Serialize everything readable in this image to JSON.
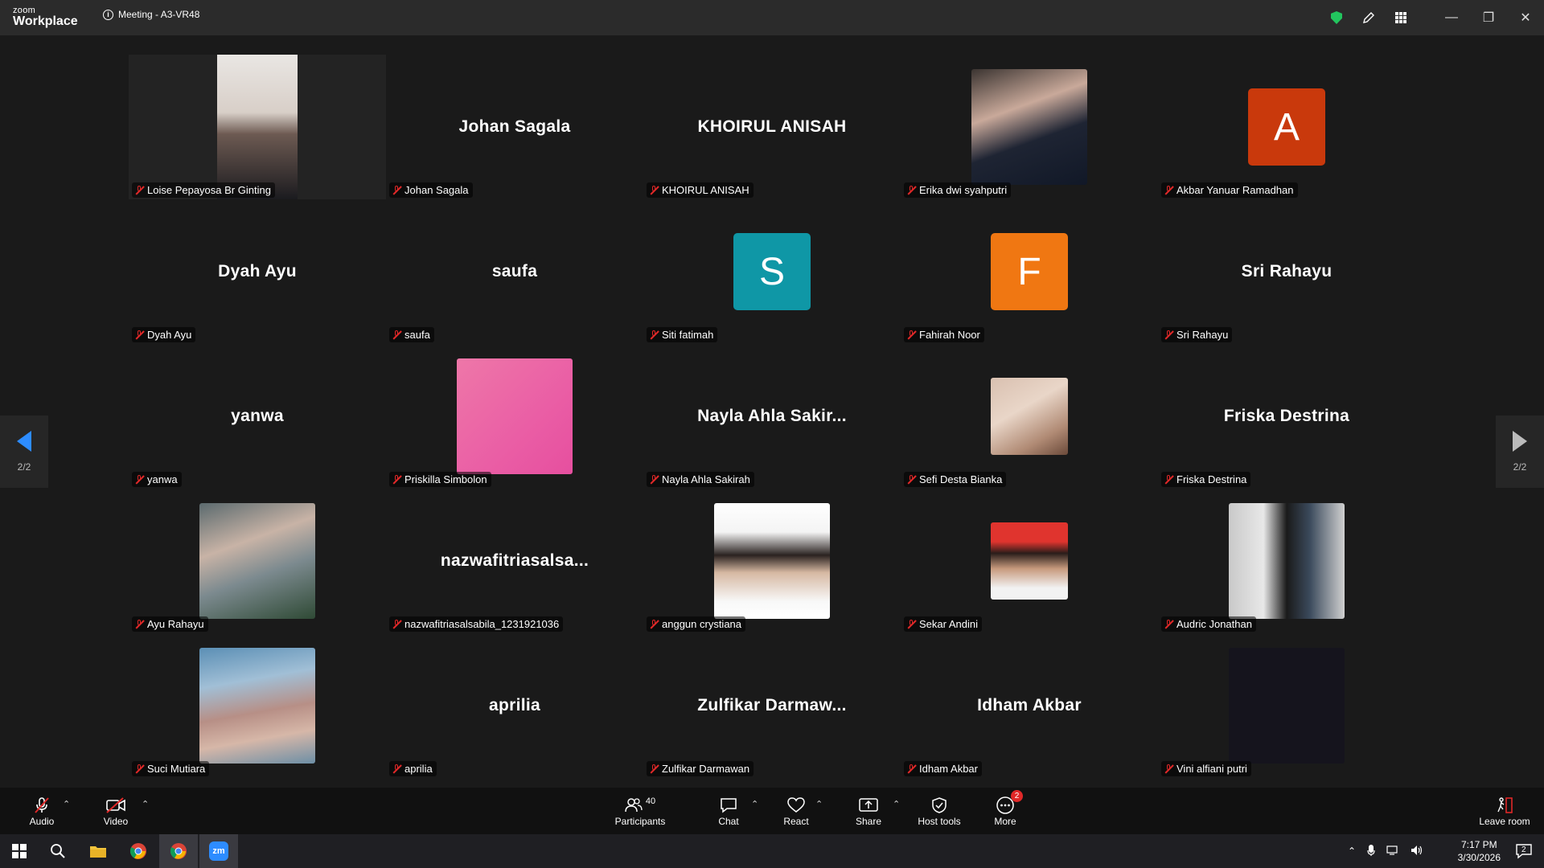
{
  "titlebar": {
    "brand_top": "zoom",
    "brand_bottom": "Workplace",
    "meeting_title": "Meeting - A3-VR48"
  },
  "colors": {
    "avatar_A": "#c9390c",
    "avatar_S": "#0f97a6",
    "avatar_F": "#f07712",
    "avatar_pink": "#ea5ea5",
    "shield": "#22c55e",
    "mic_off": "#e02828",
    "nav_active": "#2d8cff"
  },
  "gallery": {
    "page_left": "2/2",
    "page_right": "2/2",
    "tiles": [
      {
        "name": "Loise Pepayosa Br Ginting",
        "display": "",
        "type": "video"
      },
      {
        "name": "Johan Sagala",
        "display": "Johan Sagala",
        "type": "text"
      },
      {
        "name": "KHOIRUL ANISAH",
        "display": "KHOIRUL ANISAH",
        "type": "text"
      },
      {
        "name": "Erika dwi syahputri",
        "display": "",
        "type": "photo"
      },
      {
        "name": "Akbar Yanuar Ramadhan",
        "display": "A",
        "type": "avatar"
      },
      {
        "name": "Dyah Ayu",
        "display": "Dyah Ayu",
        "type": "text"
      },
      {
        "name": "saufa",
        "display": "saufa",
        "type": "text"
      },
      {
        "name": "Siti fatimah",
        "display": "S",
        "type": "avatar"
      },
      {
        "name": "Fahirah Noor",
        "display": "F",
        "type": "avatar"
      },
      {
        "name": "Sri Rahayu",
        "display": "Sri Rahayu",
        "type": "text"
      },
      {
        "name": "yanwa",
        "display": "yanwa",
        "type": "text"
      },
      {
        "name": "Priskilla Simbolon",
        "display": "",
        "type": "pink"
      },
      {
        "name": "Nayla Ahla Sakirah",
        "display": "Nayla  Ahla  Sakir...",
        "type": "text"
      },
      {
        "name": "Sefi Desta Bianka",
        "display": "",
        "type": "photo"
      },
      {
        "name": "Friska Destrina",
        "display": "Friska Destrina",
        "type": "text"
      },
      {
        "name": "Ayu Rahayu",
        "display": "",
        "type": "photo"
      },
      {
        "name": "nazwafitriasalsabila_1231921036",
        "display": "nazwafitriasalsa...",
        "type": "text"
      },
      {
        "name": "anggun crystiana",
        "display": "",
        "type": "photo"
      },
      {
        "name": "Sekar Andini",
        "display": "",
        "type": "photo"
      },
      {
        "name": "Audric Jonathan",
        "display": "",
        "type": "photo"
      },
      {
        "name": "Suci Mutiara",
        "display": "",
        "type": "photo"
      },
      {
        "name": "aprilia",
        "display": "aprilia",
        "type": "text"
      },
      {
        "name": "Zulfikar Darmawan",
        "display": "Zulfikar  Darmaw...",
        "type": "text"
      },
      {
        "name": "Idham Akbar",
        "display": "Idham Akbar",
        "type": "text"
      },
      {
        "name": "Vini alfiani putri",
        "display": "",
        "type": "photo"
      }
    ]
  },
  "toolbar": {
    "audio": "Audio",
    "video": "Video",
    "participants": "Participants",
    "participants_count": "40",
    "chat": "Chat",
    "react": "React",
    "share": "Share",
    "host_tools": "Host tools",
    "more": "More",
    "more_badge": "2",
    "leave": "Leave room"
  },
  "taskbar": {
    "time": "7:17 PM",
    "date": "3/30/2026",
    "notif_count": "2"
  }
}
